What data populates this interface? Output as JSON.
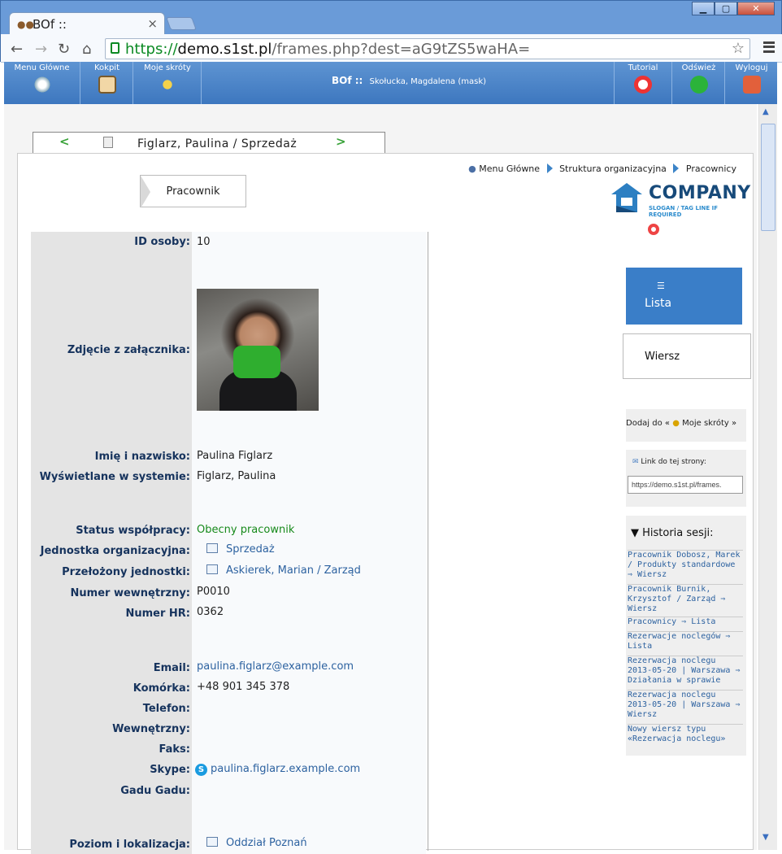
{
  "window": {
    "tab_title": "BOf ::",
    "url_scheme": "https://",
    "url_host": "demo.s1st.pl",
    "url_path": "/frames.php?dest=aG9tZS5waHA="
  },
  "header": {
    "left_buttons": [
      {
        "label": "Menu Główne"
      },
      {
        "label": "Kokpit"
      },
      {
        "label": "Moje skróty"
      }
    ],
    "title": "BOf ::",
    "user": "Skołucka, Magdalena (mask)",
    "right_buttons": [
      {
        "label": "Tutorial"
      },
      {
        "label": "Odśwież"
      },
      {
        "label": "Wyloguj"
      }
    ]
  },
  "record_tab": {
    "title": "Figlarz, Paulina / Sprzedaż"
  },
  "breadcrumb": [
    "Menu Główne",
    "Struktura organizacyjna",
    "Pracownicy"
  ],
  "pracownik_button": "Pracownik",
  "logo": {
    "brand": "COMPANY",
    "slogan": "SLOGAN / TAG LINE IF REQUIRED"
  },
  "fields": {
    "id_label": "ID osoby:",
    "id_value": "10",
    "photo_label": "Zdjęcie z załącznika:",
    "name_label": "Imię i nazwisko:",
    "name_value": "Paulina Figlarz",
    "display_label": "Wyświetlane w systemie:",
    "display_value": "Figlarz, Paulina",
    "status_label": "Status współpracy:",
    "status_value": "Obecny pracownik",
    "unit_label": "Jednostka organizacyjna:",
    "unit_value": "Sprzedaż",
    "boss_label": "Przełożony jednostki:",
    "boss_value": "Askierek, Marian / Zarząd",
    "num_label": "Numer wewnętrzny:",
    "num_value": "P0010",
    "hr_label": "Numer HR:",
    "hr_value": "0362",
    "email_label": "Email:",
    "email_value": "paulina.figlarz@example.com",
    "mobile_label": "Komórka:",
    "mobile_value": "+48 901 345 378",
    "phone_label": "Telefon:",
    "ext_label": "Wewnętrzny:",
    "fax_label": "Faks:",
    "skype_label": "Skype:",
    "skype_value": "paulina.figlarz.example.com",
    "gg_label": "Gadu Gadu:",
    "loc_label": "Poziom i lokalizacja:",
    "loc_value": "Oddział Poznań"
  },
  "sidebar": {
    "lista": "Lista",
    "wiersz": "Wiersz",
    "add_prefix": "Dodaj do «",
    "add_link": "Moje skróty",
    "add_suffix": "»",
    "link_label": "Link do tej strony:",
    "link_value": "https://demo.s1st.pl/frames.",
    "history_title": "▼ Historia sesji:",
    "history": [
      "Pracownik Dobosz, Marek / Produkty standardowe ⇒ Wiersz",
      "Pracownik Burnik, Krzysztof / Zarząd ⇒ Wiersz",
      "Pracownicy ⇒ Lista",
      "Rezerwacje noclegów ⇒ Lista",
      "Rezerwacja noclegu 2013-05-20 | Warszawa ⇒ Działania w sprawie",
      "Rezerwacja noclegu 2013-05-20 | Warszawa ⇒ Wiersz",
      "Nowy wiersz typu «Rezerwacja noclegu»"
    ]
  },
  "colors": {
    "accent": "#3a7ec8",
    "header": "#4a84c8",
    "label": "#16335d",
    "link": "#2d62a0",
    "status": "#178a1b"
  }
}
